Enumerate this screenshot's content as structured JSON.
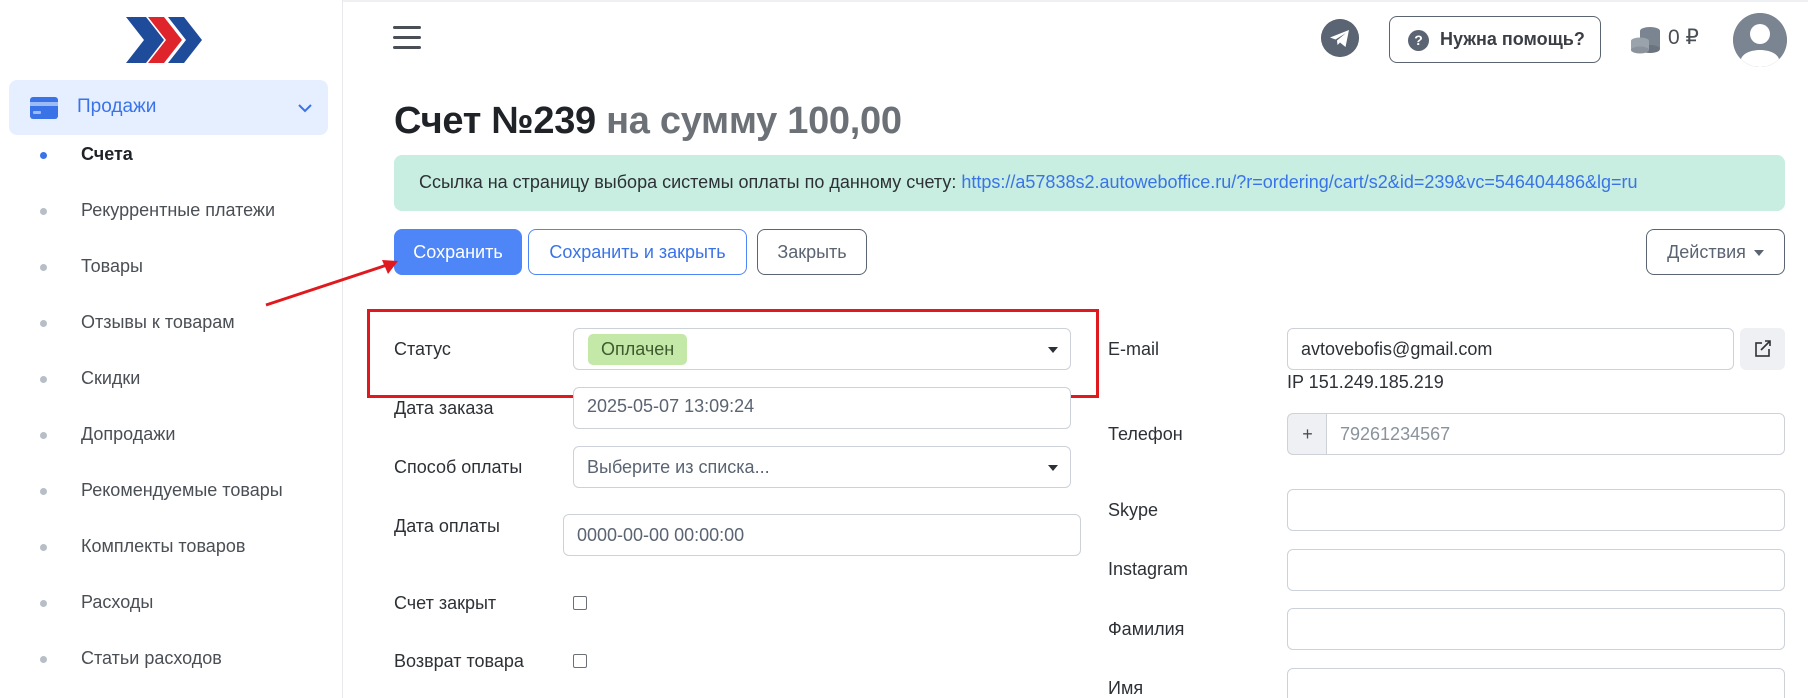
{
  "sidebar": {
    "section_label": "Продажи",
    "items": [
      {
        "label": "Счета",
        "active": true
      },
      {
        "label": "Рекуррентные платежи",
        "active": false
      },
      {
        "label": "Товары",
        "active": false
      },
      {
        "label": "Отзывы к товарам",
        "active": false
      },
      {
        "label": "Скидки",
        "active": false
      },
      {
        "label": "Допродажи",
        "active": false
      },
      {
        "label": "Рекомендуемые товары",
        "active": false
      },
      {
        "label": "Комплекты товаров",
        "active": false
      },
      {
        "label": "Расходы",
        "active": false
      },
      {
        "label": "Статьи расходов",
        "active": false
      }
    ]
  },
  "header": {
    "help_label": "Нужна помощь?",
    "balance": "0 ₽"
  },
  "invoice": {
    "title_main": "Счет №239",
    "title_amount": "на сумму 100,00",
    "payment_link_text": "Ссылка на страницу выбора системы оплаты по данному счету:",
    "payment_link_url": "https://a57838s2.autoweboffice.ru/?r=ordering/cart/s2&id=239&vc=546404486&lg=ru"
  },
  "toolbar": {
    "save_label": "Сохранить",
    "save_close_label": "Сохранить и закрыть",
    "close_label": "Закрыть",
    "actions_label": "Действия"
  },
  "form_left": {
    "status_label": "Статус",
    "status_value": "Оплачен",
    "order_date_label": "Дата заказа",
    "order_date_value": "2025-05-07 13:09:24",
    "payment_method_label": "Способ оплаты",
    "payment_method_placeholder": "Выберите из списка...",
    "payment_date_label": "Дата оплаты",
    "payment_date_value": "0000-00-00 00:00:00",
    "closed_label": "Счет закрыт",
    "return_label": "Возврат товара"
  },
  "form_right": {
    "email_label": "E-mail",
    "email_value": "avtovebofis@gmail.com",
    "ip_text": "IP 151.249.185.219",
    "phone_label": "Телефон",
    "phone_prefix": "+",
    "phone_placeholder": "79261234567",
    "skype_label": "Skype",
    "instagram_label": "Instagram",
    "lastname_label": "Фамилия",
    "firstname_label": "Имя"
  },
  "colors": {
    "accent": "#4f86f7",
    "status_badge": "#c3e8a8",
    "alert_bg": "#c7eee0",
    "annotation_red": "#e0191f"
  }
}
